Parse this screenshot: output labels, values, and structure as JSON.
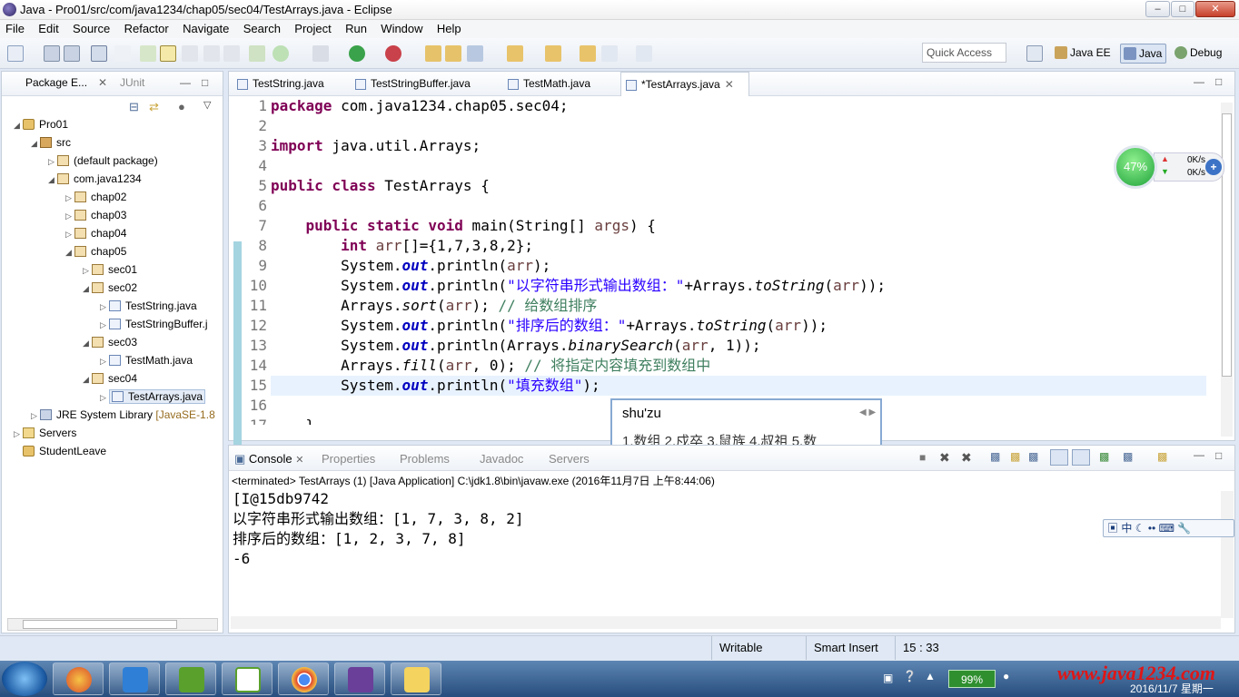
{
  "window": {
    "title": "Java - Pro01/src/com/java1234/chap05/sec04/TestArrays.java - Eclipse"
  },
  "menu": [
    "File",
    "Edit",
    "Source",
    "Refactor",
    "Navigate",
    "Search",
    "Project",
    "Run",
    "Window",
    "Help"
  ],
  "toolbar": {
    "quick_access": "Quick Access",
    "perspectives": [
      "Java EE",
      "Java",
      "Debug"
    ]
  },
  "package_explorer": {
    "tabs": [
      "Package E...",
      "JUnit"
    ],
    "tree": [
      "Pro01",
      "src",
      "(default package)",
      "com.java1234",
      "chap02",
      "chap03",
      "chap04",
      "chap05",
      "sec01",
      "sec02",
      "TestString.java",
      "TestStringBuffer.j",
      "sec03",
      "TestMath.java",
      "sec04",
      "TestArrays.java",
      "JRE System Library",
      "[JavaSE-1.8",
      "Servers",
      "StudentLeave"
    ]
  },
  "editor": {
    "tabs": [
      "TestString.java",
      "TestStringBuffer.java",
      "TestMath.java",
      "*TestArrays.java"
    ],
    "line_numbers": [
      "1",
      "2",
      "3",
      "4",
      "5",
      "6",
      "7",
      "8",
      "9",
      "10",
      "11",
      "12",
      "13",
      "14",
      "15",
      "16",
      "17"
    ],
    "code": {
      "l1_kw": "package",
      "l1_rest": " com.java1234.chap05.sec04;",
      "l3_kw": "import",
      "l3_rest": " java.util.Arrays;",
      "l5_kw": "public class",
      "l5_rest": " TestArrays {",
      "l7_kw": "public static void",
      "l7_rest": " main(String[] ",
      "l7_var": "args",
      "l7_end": ") {",
      "l8_kw": "int",
      "l8_var": "arr",
      "l8_rest": "[]={1,7,3,8,2};",
      "sys": "System.",
      "out": "out",
      "println": ".println(",
      "l9_arg": "arr",
      "l9_end": ");",
      "l10_str": "\"以字符串形式输出数组：\"",
      "l10_mid": "+Arrays.",
      "l10_m": "toString",
      "l10_arg": "arr",
      "l10_end": "));",
      "l11_a": "Arrays.",
      "l11_m": "sort",
      "l11_arg": "arr",
      "l11_b": "); ",
      "l11_c": "// 给数组排序",
      "l12_str": "\"排序后的数组：\"",
      "l12_mid": "+Arrays.",
      "l12_m": "toString",
      "l12_arg": "arr",
      "l12_end": "));",
      "l13_a": "Arrays.",
      "l13_m": "binarySearch",
      "l13_arg": "arr",
      "l13_end": ", 1));",
      "l14_a": "Arrays.",
      "l14_m": "fill",
      "l14_arg": "arr",
      "l14_b": ", 0); ",
      "l14_c": "// 将指定内容填充到数组中",
      "l15_str": "\"填充数组\"",
      "l15_end": ");",
      "l17": "}"
    }
  },
  "ime_popup": {
    "pinyin": "shu'zu",
    "candidates": "1.数组  2.戍卒  3.鼠族  4.叔祖  5.数"
  },
  "speed_widget": {
    "percent": "47%",
    "up": "0K/s",
    "down": "0K/s"
  },
  "console": {
    "tabs": [
      "Console",
      "Properties",
      "Problems",
      "Javadoc",
      "Servers"
    ],
    "status": "<terminated> TestArrays (1) [Java Application] C:\\jdk1.8\\bin\\javaw.exe (2016年11月7日 上午8:44:06)",
    "output": [
      "[I@15db9742",
      "以字符串形式输出数组：[1, 7, 3, 8, 2]",
      "排序后的数组：[1, 2, 3, 7, 8]",
      "-6"
    ]
  },
  "ime_bar": {
    "label": "中"
  },
  "statusbar": {
    "writable": "Writable",
    "insert_mode": "Smart Insert",
    "position": "15 : 33"
  },
  "taskbar": {
    "battery": "99%",
    "watermark": "www.java1234.com",
    "date": "2016/11/7 星期一"
  }
}
